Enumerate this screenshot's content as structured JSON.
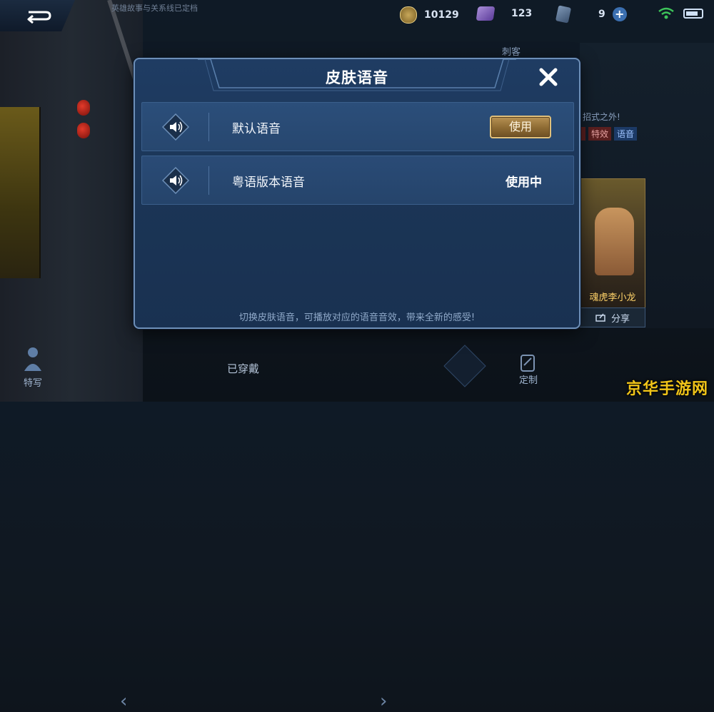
{
  "top_bar": {
    "note_text": "英雄故事与关系线已定档",
    "gold": "10129",
    "gems": "123",
    "cards": "9"
  },
  "background": {
    "role_label": "刺客",
    "tagline": "招式之外!",
    "tags": [
      "",
      "特效",
      "语音"
    ],
    "card_name": "魂虎李小龙",
    "share_label": "分享"
  },
  "bottom_bar": {
    "left_label": "特写",
    "center_label": "已穿戴",
    "right_label": "定制"
  },
  "modal": {
    "title": "皮肤语音",
    "rows": [
      {
        "label": "默认语音",
        "action": "使用"
      },
      {
        "label": "粤语版本语音",
        "status": "使用中"
      }
    ],
    "footer": "切换皮肤语音，可播放对应的语音音效，带来全新的感受!"
  },
  "watermark": "京华手游网",
  "colors": {
    "modal_bg": "#1f3c63",
    "row_bg": "#2b4e7a",
    "use_button": "#b79253",
    "watermark": "#f0c419"
  }
}
